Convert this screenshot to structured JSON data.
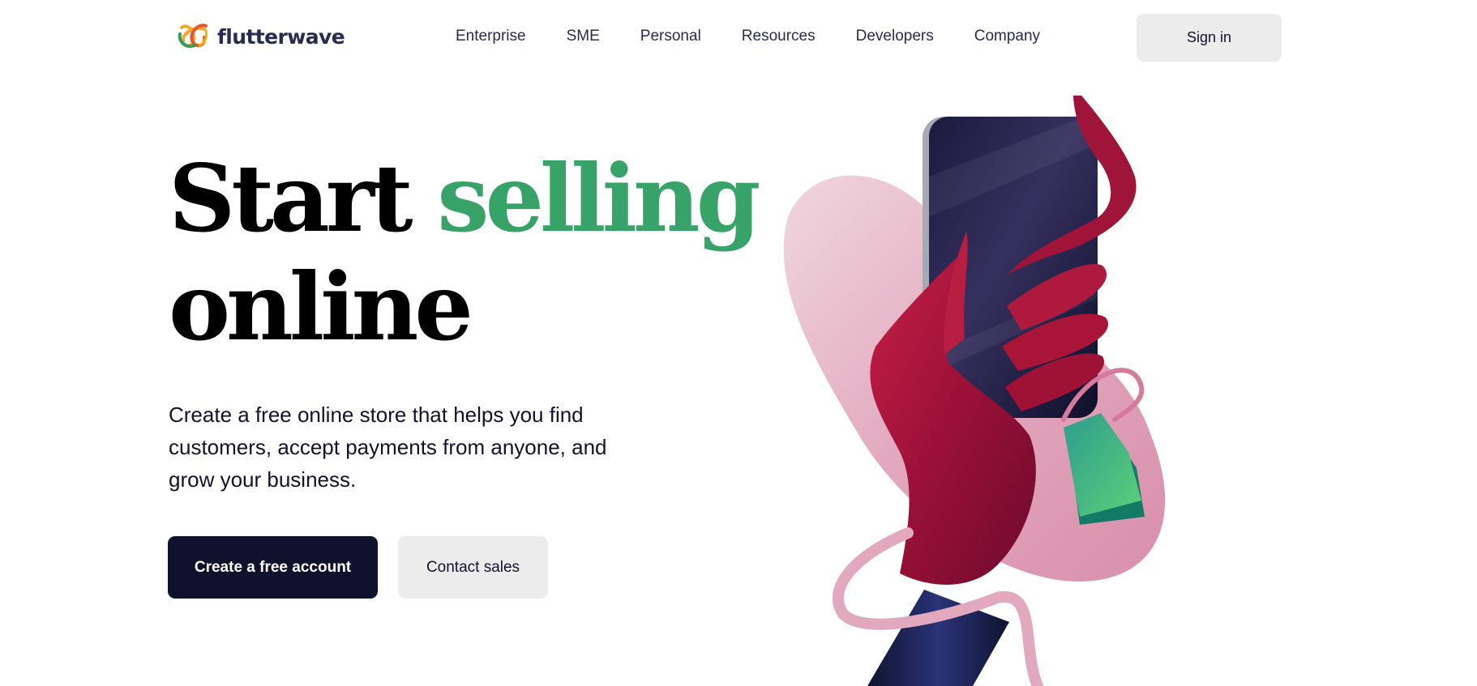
{
  "brand": {
    "name": "flutterwave",
    "colors": {
      "accent_green": "#38a368",
      "navy": "#10112c",
      "button_gray": "#ececec"
    },
    "logo_icon": "flutterwave-heart-logo-icon"
  },
  "nav": {
    "items": [
      {
        "label": "Enterprise"
      },
      {
        "label": "SME"
      },
      {
        "label": "Personal"
      },
      {
        "label": "Resources"
      },
      {
        "label": "Developers"
      },
      {
        "label": "Company"
      }
    ],
    "sign_in_label": "Sign in"
  },
  "hero": {
    "title_part1": "Start ",
    "title_accent": "selling",
    "title_part2": "online",
    "description": "Create a free online store that helps you find customers, accept payments from anyone, and grow your business.",
    "primary_cta": "Create a free account",
    "secondary_cta": "Contact sales",
    "illustration": "hand-holding-phone-with-shopping-tag-illustration"
  }
}
